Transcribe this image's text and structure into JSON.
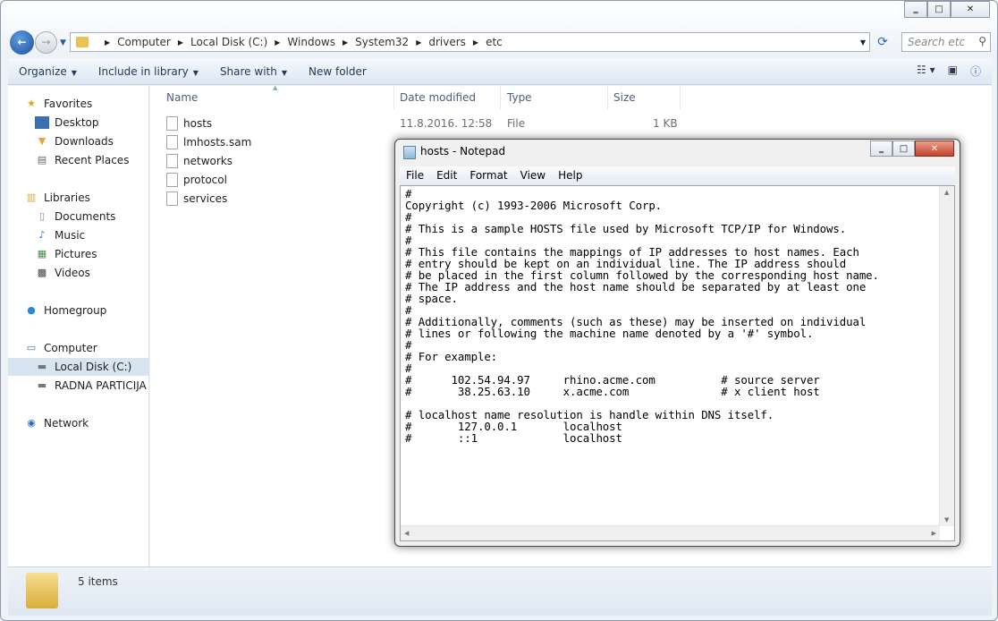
{
  "explorer": {
    "caption": {
      "minimize": "‗",
      "maximize": "□",
      "close": "✕"
    },
    "breadcrumb": [
      "Computer",
      "Local Disk (C:)",
      "Windows",
      "System32",
      "drivers",
      "etc"
    ],
    "search_placeholder": "Search etc",
    "toolbar": {
      "organize": "Organize",
      "include": "Include in library",
      "share": "Share with",
      "new_folder": "New folder"
    },
    "sidebar": {
      "favorites": "Favorites",
      "desktop": "Desktop",
      "downloads": "Downloads",
      "recent": "Recent Places",
      "libraries": "Libraries",
      "documents": "Documents",
      "music": "Music",
      "pictures": "Pictures",
      "videos": "Videos",
      "homegroup": "Homegroup",
      "computer": "Computer",
      "local_disk": "Local Disk (C:)",
      "radna": "RADNA PARTICIJA (",
      "network": "Network"
    },
    "columns": {
      "name": "Name",
      "date": "Date modified",
      "type": "Type",
      "size": "Size"
    },
    "files": [
      {
        "name": "hosts",
        "date": "11.8.2016. 12:58",
        "type": "File",
        "size": "1 KB"
      },
      {
        "name": "lmhosts.sam"
      },
      {
        "name": "networks"
      },
      {
        "name": "protocol"
      },
      {
        "name": "services"
      }
    ],
    "status": "5 items"
  },
  "notepad": {
    "title": "hosts - Notepad",
    "menu": [
      "File",
      "Edit",
      "Format",
      "View",
      "Help"
    ],
    "text": "#\nCopyright (c) 1993-2006 Microsoft Corp.\n#\n# This is a sample HOSTS file used by Microsoft TCP/IP for Windows.\n#\n# This file contains the mappings of IP addresses to host names. Each\n# entry should be kept on an individual line. The IP address should\n# be placed in the first column followed by the corresponding host name.\n# The IP address and the host name should be separated by at least one\n# space.\n#\n# Additionally, comments (such as these) may be inserted on individual\n# lines or following the machine name denoted by a '#' symbol.\n#\n# For example:\n#\n#      102.54.94.97     rhino.acme.com          # source server\n#       38.25.63.10     x.acme.com              # x client host\n\n# localhost name resolution is handle within DNS itself.\n#\t127.0.0.1       localhost\n#\t::1             localhost"
  }
}
